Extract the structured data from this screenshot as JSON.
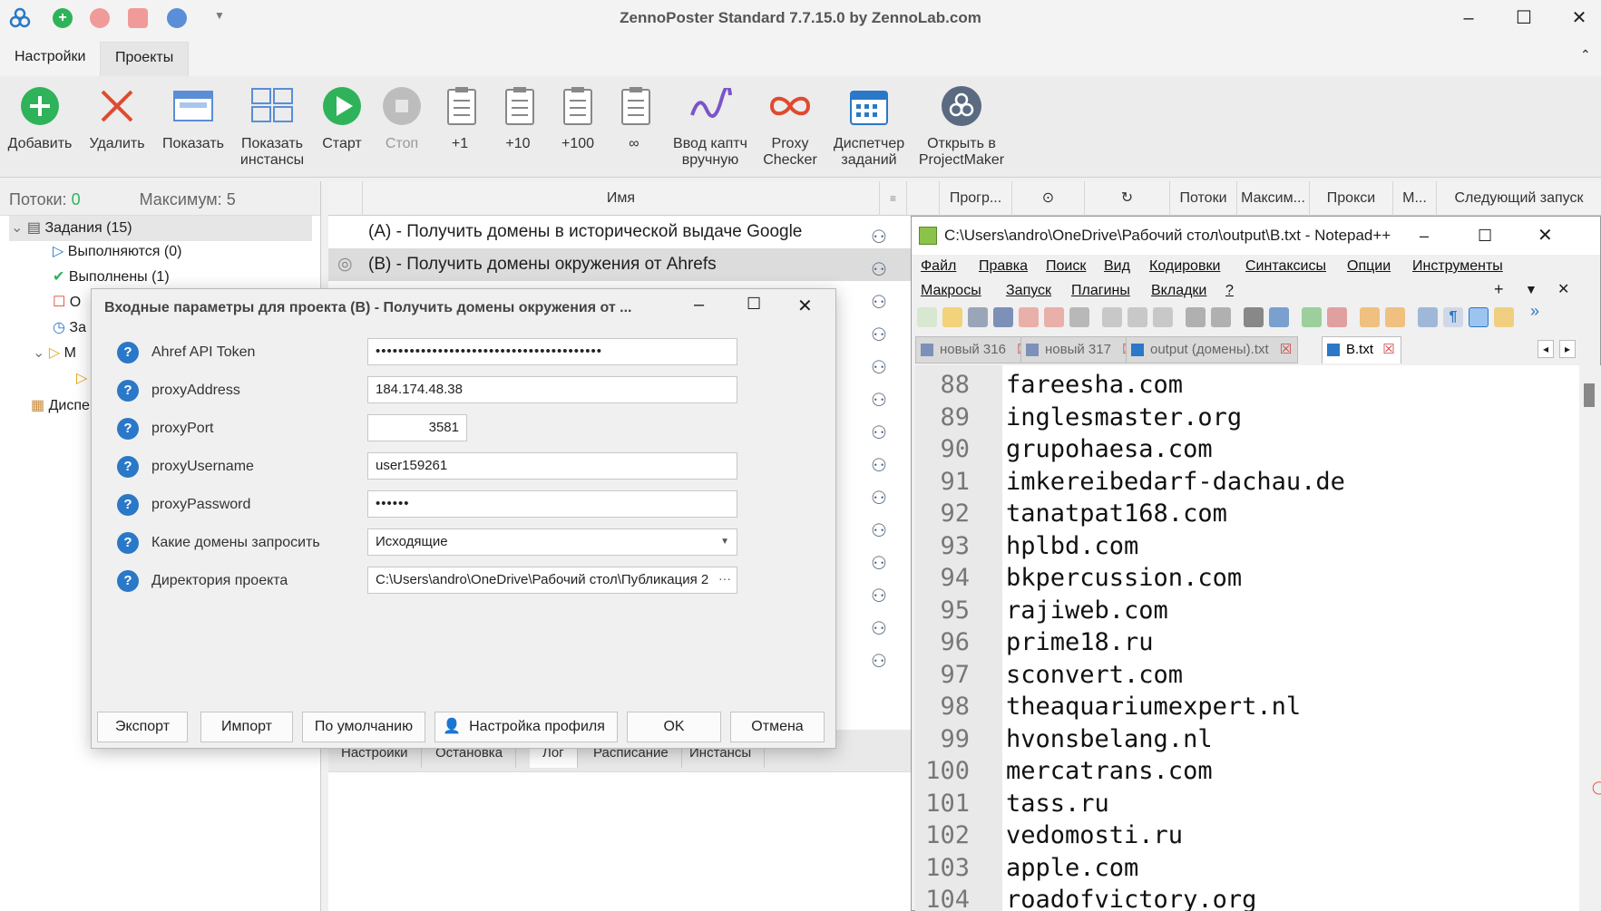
{
  "app": {
    "title": "ZennoPoster Standard 7.7.15.0 by ZennoLab.com",
    "menu_tabs": [
      "Настройки",
      "Проекты"
    ]
  },
  "ribbon": [
    {
      "label": "Добавить",
      "icon": "add-icon"
    },
    {
      "label": "Удалить",
      "icon": "delete-icon"
    },
    {
      "label": "Показать",
      "icon": "show-icon"
    },
    {
      "label": "Показать инстансы",
      "icon": "instances-icon"
    },
    {
      "label": "Старт",
      "icon": "play-icon"
    },
    {
      "label": "Стоп",
      "icon": "stop-icon"
    },
    {
      "label": "+1",
      "icon": "clipboard-icon"
    },
    {
      "label": "+10",
      "icon": "clipboard-icon"
    },
    {
      "label": "+100",
      "icon": "clipboard-icon"
    },
    {
      "label": "∞",
      "icon": "clipboard-icon"
    },
    {
      "label": "Ввод каптч вручную",
      "icon": "captcha-icon"
    },
    {
      "label": "Proxy Checker",
      "icon": "proxy-checker-icon"
    },
    {
      "label": "Диспетчер заданий",
      "icon": "scheduler-icon"
    },
    {
      "label": "Открыть в ProjectMaker",
      "icon": "projectmaker-icon"
    }
  ],
  "left": {
    "threads_label": "Потоки:",
    "threads_value": "0",
    "max_label": "Максимум:",
    "max_value": "5",
    "tree": [
      "Задания (15)",
      "Выполняются (0)",
      "Выполнены (1)",
      "О",
      "За",
      "М",
      "",
      "Диспе"
    ]
  },
  "table": {
    "columns": [
      "Имя",
      "Прогр...",
      "",
      "",
      "Потоки",
      "Максим...",
      "Прокси",
      "М...",
      "Следующий запуск"
    ],
    "rows": [
      "(A) - Получить домены в исторической выдаче Google",
      "(B) - Получить домены окружения от Ahrefs"
    ]
  },
  "bottom_tabs": [
    "Настройки",
    "Остановка",
    "Лог",
    "Расписание",
    "Инстансы"
  ],
  "dialog": {
    "title": "Входные параметры для проекта (B) - Получить домены окружения от ...",
    "fields": [
      {
        "label": "Ahref API Token",
        "value": "••••••••••••••••••••••••••••••••••••••••"
      },
      {
        "label": "proxyAddress",
        "value": "184.174.48.38"
      },
      {
        "label": "proxyPort",
        "value": "3581"
      },
      {
        "label": "proxyUsername",
        "value": "user159261"
      },
      {
        "label": "proxyPassword",
        "value": "••••••"
      },
      {
        "label": "Какие домены запросить",
        "value": "Исходящие"
      },
      {
        "label": "Директория проекта",
        "value": "C:\\Users\\andro\\OneDrive\\Рабочий стол\\Публикация 2"
      }
    ],
    "buttons": [
      "Экспорт",
      "Импорт",
      "По умолчанию",
      "Настройка профиля",
      "OK",
      "Отмена"
    ]
  },
  "npp": {
    "title": "C:\\Users\\andro\\OneDrive\\Рабочий стол\\output\\B.txt - Notepad++",
    "menu_row1": [
      "Файл",
      "Правка",
      "Поиск",
      "Вид",
      "Кодировки",
      "Синтаксисы",
      "Опции",
      "Инструменты"
    ],
    "menu_row2": [
      "Макросы",
      "Запуск",
      "Плагины",
      "Вкладки",
      "?"
    ],
    "tabs": [
      "новый 316",
      "новый 317",
      "output (домены).txt",
      "B.txt"
    ],
    "lines": [
      {
        "n": "88",
        "t": "fareesha.com"
      },
      {
        "n": "89",
        "t": "inglesmaster.org"
      },
      {
        "n": "90",
        "t": "grupohaesa.com"
      },
      {
        "n": "91",
        "t": "imkereibedarf-dachau.de"
      },
      {
        "n": "92",
        "t": "tanatpat168.com"
      },
      {
        "n": "93",
        "t": "hplbd.com"
      },
      {
        "n": "94",
        "t": "bkpercussion.com"
      },
      {
        "n": "95",
        "t": "rajiweb.com"
      },
      {
        "n": "96",
        "t": "prime18.ru"
      },
      {
        "n": "97",
        "t": "sconvert.com"
      },
      {
        "n": "98",
        "t": "theaquariumexpert.nl"
      },
      {
        "n": "99",
        "t": "hvonsbelang.nl"
      },
      {
        "n": "100",
        "t": "mercatrans.com"
      },
      {
        "n": "101",
        "t": "tass.ru"
      },
      {
        "n": "102",
        "t": "vedomosti.ru"
      },
      {
        "n": "103",
        "t": "apple.com"
      },
      {
        "n": "104",
        "t": "roadofvictory.org"
      }
    ]
  },
  "colors": {
    "accent_green": "#2fb35a",
    "accent_blue": "#2a78c7",
    "red": "#e04a2f"
  }
}
